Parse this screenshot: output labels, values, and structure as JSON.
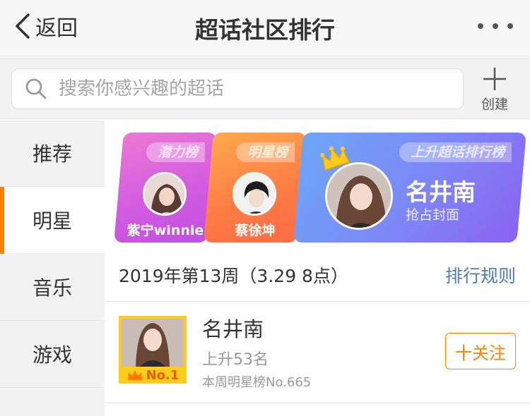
{
  "navbar": {
    "back_label": "返回",
    "title": "超话社区排行"
  },
  "search": {
    "placeholder": "搜索你感兴趣的超话"
  },
  "create": {
    "label": "创建"
  },
  "sidebar": {
    "items": [
      {
        "label": "推荐"
      },
      {
        "label": "明星"
      },
      {
        "label": "音乐"
      },
      {
        "label": "游戏"
      }
    ],
    "active_index": 1
  },
  "banner": {
    "cards": [
      {
        "tag": "潜力榜",
        "name": "紫宁winnie"
      },
      {
        "tag": "明星榜",
        "name": "蔡徐坤"
      },
      {
        "tag": "上升超话排行榜",
        "name": "名井南",
        "subtitle": "抢占封面"
      }
    ]
  },
  "week": {
    "label": "2019年第13周（3.29 8点）",
    "rules_label": "排行规则"
  },
  "ranking": [
    {
      "badge": "No.1",
      "name": "名井南",
      "change": "上升53名",
      "week_rank": "本周明星榜No.665",
      "follow_label": "十关注"
    }
  ],
  "colors": {
    "accent": "#ff8200",
    "link": "#4d7cb7",
    "rank_badge_bg": "#ffcc1a"
  }
}
